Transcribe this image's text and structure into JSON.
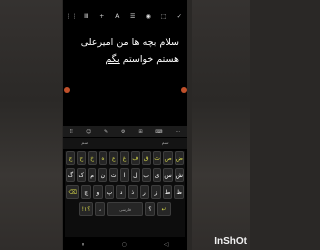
{
  "status": {
    "time": "",
    "icons": ""
  },
  "toolbar": {
    "items": [
      {
        "name": "grid-icon",
        "glyph": "⋮⋮"
      },
      {
        "name": "format-icon",
        "glyph": "Ⅲ"
      },
      {
        "name": "text-plus-icon",
        "glyph": "+"
      },
      {
        "name": "text-size-icon",
        "glyph": "A"
      },
      {
        "name": "list-icon",
        "glyph": "☰"
      },
      {
        "name": "color-icon",
        "glyph": "◉"
      },
      {
        "name": "share-icon",
        "glyph": "⬚"
      },
      {
        "name": "check-icon",
        "glyph": "✓"
      }
    ]
  },
  "note": {
    "line1": "سلام بچه ها من امیرعلی",
    "line2a": "هستم خواستم ",
    "line2b": "بگم"
  },
  "keyboard": {
    "tools": [
      "⠿",
      "☺",
      "✎",
      "⚙",
      "⊞",
      "⌨",
      "⋯"
    ],
    "suggestions": [
      "سم",
      "",
      "سم"
    ],
    "rows": [
      [
        "ض",
        "ص",
        "ث",
        "ق",
        "ف",
        "غ",
        "ع",
        "ه",
        "خ",
        "ح",
        "ج"
      ],
      [
        "ش",
        "س",
        "ی",
        "ب",
        "ل",
        "ا",
        "ت",
        "ن",
        "م",
        "ک",
        "گ"
      ],
      [
        "ظ",
        "ط",
        "ز",
        "ر",
        "ذ",
        "د",
        "پ",
        "و",
        "چ",
        "⌫"
      ],
      [
        "!؟۱",
        "،",
        "فارسی",
        "؟",
        "↵"
      ]
    ]
  },
  "navbar": [
    "⏸",
    "○",
    "◁"
  ],
  "watermark": "InShOt"
}
